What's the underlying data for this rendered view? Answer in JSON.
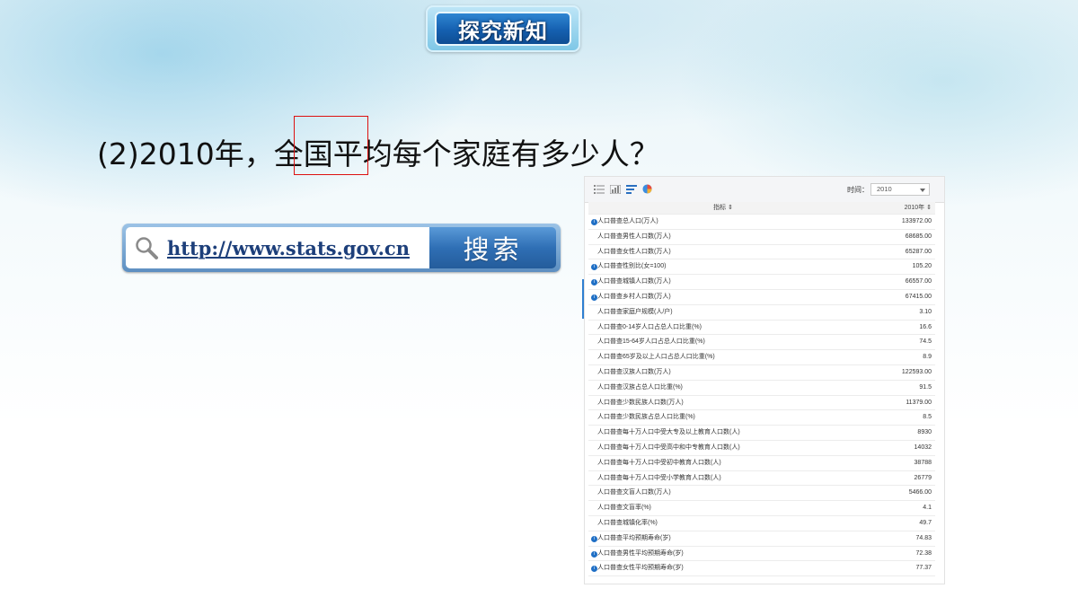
{
  "badge": {
    "title": "探究新知"
  },
  "question": {
    "prefix": "(2)2010年，",
    "highlight": "全国",
    "suffix": "平均每个家庭有多少人？"
  },
  "search": {
    "url": "http://www.stats.gov.cn",
    "button_label": "搜索",
    "icon": "magnifier-icon"
  },
  "panel": {
    "toolbar_icons": [
      "table-view-icon",
      "bar-chart-icon",
      "horizontal-bar-icon",
      "pie-chart-icon"
    ],
    "time_label": "时间：",
    "time_value": "2010",
    "header_indicator": "指标 ⇕",
    "header_value": "2010年 ⇕",
    "rows": [
      {
        "label": "人口普查总人口(万人)",
        "value": "133972.00",
        "info": true
      },
      {
        "label": "人口普查男性人口数(万人)",
        "value": "68685.00",
        "info": false
      },
      {
        "label": "人口普查女性人口数(万人)",
        "value": "65287.00",
        "info": false
      },
      {
        "label": "人口普查性别比(女=100)",
        "value": "105.20",
        "info": true
      },
      {
        "label": "人口普查城镇人口数(万人)",
        "value": "66557.00",
        "info": true
      },
      {
        "label": "人口普查乡村人口数(万人)",
        "value": "67415.00",
        "info": true
      },
      {
        "label": "人口普查家庭户规模(人/户)",
        "value": "3.10",
        "info": false
      },
      {
        "label": "人口普查0-14岁人口占总人口比重(%)",
        "value": "16.6",
        "info": false
      },
      {
        "label": "人口普查15-64岁人口占总人口比重(%)",
        "value": "74.5",
        "info": false
      },
      {
        "label": "人口普查65岁及以上人口占总人口比重(%)",
        "value": "8.9",
        "info": false
      },
      {
        "label": "人口普查汉族人口数(万人)",
        "value": "122593.00",
        "info": false
      },
      {
        "label": "人口普查汉族占总人口比重(%)",
        "value": "91.5",
        "info": false
      },
      {
        "label": "人口普查少数民族人口数(万人)",
        "value": "11379.00",
        "info": false
      },
      {
        "label": "人口普查少数民族占总人口比重(%)",
        "value": "8.5",
        "info": false
      },
      {
        "label": "人口普查每十万人口中受大专及以上教育人口数(人)",
        "value": "8930",
        "info": false
      },
      {
        "label": "人口普查每十万人口中受高中和中专教育人口数(人)",
        "value": "14032",
        "info": false
      },
      {
        "label": "人口普查每十万人口中受初中教育人口数(人)",
        "value": "38788",
        "info": false
      },
      {
        "label": "人口普查每十万人口中受小学教育人口数(人)",
        "value": "26779",
        "info": false
      },
      {
        "label": "人口普查文盲人口数(万人)",
        "value": "5466.00",
        "info": false
      },
      {
        "label": "人口普查文盲率(%)",
        "value": "4.1",
        "info": false
      },
      {
        "label": "人口普查城镇化率(%)",
        "value": "49.7",
        "info": false
      },
      {
        "label": "人口普查平均预期寿命(岁)",
        "value": "74.83",
        "info": true
      },
      {
        "label": "人口普查男性平均预期寿命(岁)",
        "value": "72.38",
        "info": true
      },
      {
        "label": "人口普查女性平均预期寿命(岁)",
        "value": "77.37",
        "info": true
      }
    ]
  },
  "colors": {
    "accent": "#1560b0",
    "highlight_border": "#d11111",
    "link": "#1d3f7a"
  }
}
